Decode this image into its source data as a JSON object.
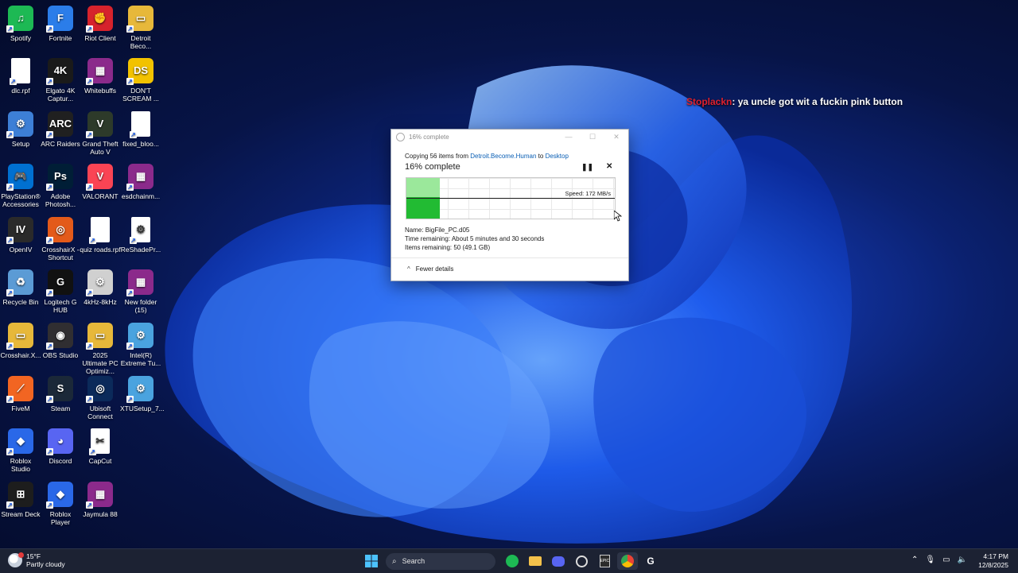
{
  "desktop": {
    "icons": [
      {
        "label": "Spotify",
        "glyph": "♫",
        "color": "#1db954"
      },
      {
        "label": "Fortnite",
        "glyph": "F",
        "color": "#2b7de9"
      },
      {
        "label": "Riot Client",
        "glyph": "✊",
        "color": "#d6232c"
      },
      {
        "label": "Detroit Beco...",
        "glyph": "▭",
        "color": "#e7b83a"
      },
      {
        "label": "dlc.rpf",
        "glyph": "",
        "color": "#ffffff"
      },
      {
        "label": "Elgato 4K Captur...",
        "glyph": "4K",
        "color": "#1a1a1a"
      },
      {
        "label": "Whitebuffs",
        "glyph": "▦",
        "color": "#8b2a8b"
      },
      {
        "label": "DON'T SCREAM ...",
        "glyph": "DS",
        "color": "#f2c200"
      },
      {
        "label": "Setup",
        "glyph": "⚙",
        "color": "#3d7fd6"
      },
      {
        "label": "ARC Raiders",
        "glyph": "ARC",
        "color": "#202020"
      },
      {
        "label": "Grand Theft Auto V",
        "glyph": "V",
        "color": "#2d3a2a"
      },
      {
        "label": "fixed_bloo...",
        "glyph": "",
        "color": "#ffffff"
      },
      {
        "label": "PlayStation® Accessories",
        "glyph": "🎮",
        "color": "#0070d1"
      },
      {
        "label": "Adobe Photosh...",
        "glyph": "Ps",
        "color": "#001e36"
      },
      {
        "label": "VALORANT",
        "glyph": "V",
        "color": "#fa4454"
      },
      {
        "label": "esdchainm...",
        "glyph": "▦",
        "color": "#8b2a8b"
      },
      {
        "label": "OpenIV",
        "glyph": "IV",
        "color": "#2a2a2a"
      },
      {
        "label": "CrosshairX - Shortcut",
        "glyph": "◎",
        "color": "#e35a1a"
      },
      {
        "label": "quiz roads.rpf",
        "glyph": "",
        "color": "#ffffff"
      },
      {
        "label": "ReShadePr...",
        "glyph": "⚙",
        "color": "#ffffff"
      },
      {
        "label": "Recycle Bin",
        "glyph": "♻",
        "color": "#5b9bd5"
      },
      {
        "label": "Logitech G HUB",
        "glyph": "G",
        "color": "#111111"
      },
      {
        "label": "4kHz-8kHz",
        "glyph": "⚙",
        "color": "#d0d0d0"
      },
      {
        "label": "New folder (15)",
        "glyph": "▦",
        "color": "#8b2a8b"
      },
      {
        "label": "Crosshair.X...",
        "glyph": "▭",
        "color": "#e7b83a"
      },
      {
        "label": "OBS Studio",
        "glyph": "◉",
        "color": "#302e31"
      },
      {
        "label": "2025 Ultimate PC Optimiz...",
        "glyph": "▭",
        "color": "#e7b83a"
      },
      {
        "label": "Intel(R) Extreme Tu...",
        "glyph": "⚙",
        "color": "#4aa3df"
      },
      {
        "label": "FiveM",
        "glyph": "⟋",
        "color": "#f26522"
      },
      {
        "label": "Steam",
        "glyph": "S",
        "color": "#1b2838"
      },
      {
        "label": "Ubisoft Connect",
        "glyph": "◎",
        "color": "#0b2a5a"
      },
      {
        "label": "XTUSetup_7...",
        "glyph": "⚙",
        "color": "#4aa3df"
      },
      {
        "label": "Roblox Studio",
        "glyph": "◆",
        "color": "#2a68e8"
      },
      {
        "label": "Discord",
        "glyph": "◕",
        "color": "#5865f2"
      },
      {
        "label": "CapCut",
        "glyph": "✂",
        "color": "#ffffff"
      },
      {
        "label": "",
        "glyph": "",
        "color": "transparent"
      },
      {
        "label": "Stream Deck",
        "glyph": "⊞",
        "color": "#1d1d1d"
      },
      {
        "label": "Roblox Player",
        "glyph": "◆",
        "color": "#2a68e8"
      },
      {
        "label": "Jaymula 88",
        "glyph": "▦",
        "color": "#8b2a8b"
      }
    ]
  },
  "chat": {
    "username": "Stoplackn",
    "message": ": ya uncle got wit a fuckin pink button"
  },
  "dialog": {
    "window_title": "16% complete",
    "copy_prefix": "Copying 56 items from",
    "source": "Detroit.Become.Human",
    "to_word": "to",
    "destination": "Desktop",
    "heading": "16% complete",
    "progress_percent": 16,
    "speed": "Speed: 172 MB/s",
    "name_line": "Name:  BigFile_PC.d05",
    "time_line": "Time remaining:  About 5 minutes and 30 seconds",
    "items_line": "Items remaining:  50 (49.1 GB)",
    "fewer_details": "Fewer details"
  },
  "taskbar": {
    "temperature": "15°F",
    "weather": "Partly cloudy",
    "search_placeholder": "Search",
    "time": "4:17 PM",
    "date": "12/8/2025"
  },
  "colors": {
    "accent": "#0a5fb5",
    "progress_green": "#22bb33",
    "taskbar_bg": "#1c2233"
  }
}
